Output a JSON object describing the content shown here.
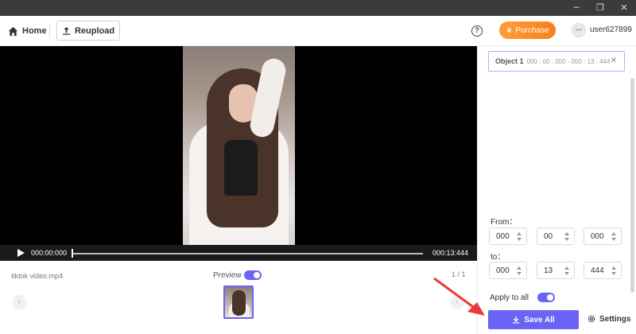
{
  "window": {
    "minimize": "─",
    "restore": "❐",
    "close": "✕"
  },
  "header": {
    "home_label": "Home",
    "reupload_label": "Reupload",
    "help_glyph": "?",
    "purchase_label": "Purchase",
    "avatar_glyph": "•••",
    "username": "user627899"
  },
  "player": {
    "current_time": "000:00:000",
    "end_time": "000:13:444",
    "progress": 0
  },
  "strip": {
    "filename": "tiktok video.mp4",
    "preview_label": "Preview",
    "preview_on": true,
    "pager": "1 / 1",
    "prev_glyph": "‹",
    "next_glyph": "›"
  },
  "objects": [
    {
      "name": "Object 1",
      "range": "000 : 00 : 000 - 000 : 13 : 444",
      "close_glyph": "✕"
    }
  ],
  "range": {
    "from_label": "From：",
    "to_label": "to：",
    "from": [
      "000",
      "00",
      "000"
    ],
    "to": [
      "000",
      "13",
      "444"
    ]
  },
  "apply_all": {
    "label": "Apply to all",
    "on": true
  },
  "actions": {
    "save_all_label": "Save All",
    "settings_label": "Settings"
  },
  "colors": {
    "accent": "#6b63f6",
    "purchase": "#f7801a",
    "annotation": "#e83a3a"
  },
  "icons": [
    "home-icon",
    "upload-icon",
    "help-icon",
    "crown-icon",
    "play-icon",
    "download-icon",
    "gear-icon"
  ]
}
